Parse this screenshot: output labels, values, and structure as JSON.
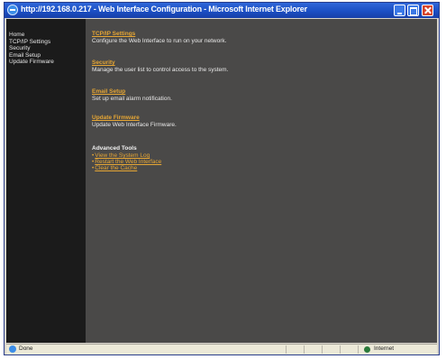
{
  "window": {
    "title": "http://192.168.0.217 - Web Interface Configuration - Microsoft Internet Explorer"
  },
  "sidebar": {
    "items": [
      {
        "label": "Home"
      },
      {
        "label": "TCP/IP Settings"
      },
      {
        "label": "Security"
      },
      {
        "label": "Email Setup"
      },
      {
        "label": "Update Firmware"
      }
    ]
  },
  "main": {
    "sections": [
      {
        "link": "TCP/IP Settings",
        "description": "Configure the Web Interface to run on your network."
      },
      {
        "link": "Security",
        "description": "Manage the user list to control access to the system."
      },
      {
        "link": "Email Setup",
        "description": "Set up email alarm notification."
      },
      {
        "link": "Update Firmware",
        "description": "Update Web Interface Firmware."
      }
    ],
    "advanced": {
      "heading": "Advanced Tools",
      "items": [
        {
          "label": "View the System Log"
        },
        {
          "label": "Restart the Web Interface"
        },
        {
          "label": "Clear the Cache"
        }
      ]
    }
  },
  "statusbar": {
    "text": "Done",
    "zone": "Internet"
  },
  "colors": {
    "link": "#e6a634",
    "background": "#4a4948",
    "sidebar": "#1b1b1b",
    "titlebar": "#1b4fc4"
  },
  "icons": [
    "ie-icon",
    "minimize-icon",
    "maximize-icon",
    "close-icon",
    "page-done-icon",
    "internet-zone-icon"
  ]
}
